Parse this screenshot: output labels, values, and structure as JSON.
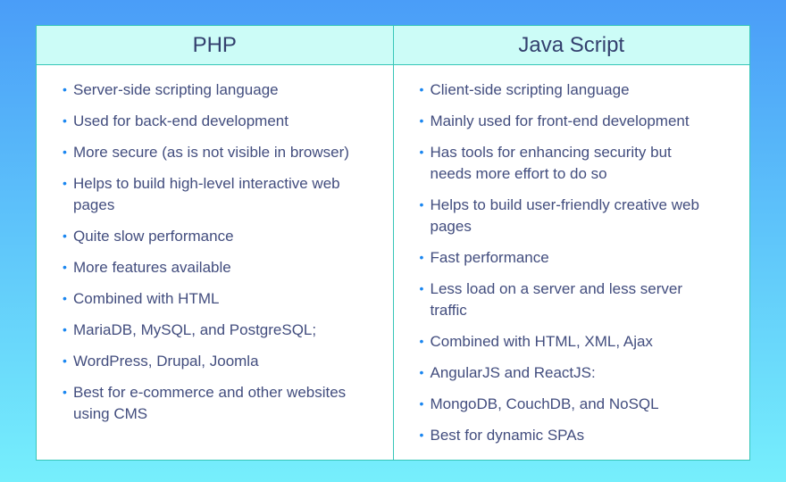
{
  "columns": [
    {
      "title": "PHP",
      "items": [
        "Server-side scripting language",
        "Used for back-end development",
        "More secure (as is not visible in browser)",
        "Helps to build high-level interactive web pages",
        "Quite slow performance",
        "More features available",
        "Combined with HTML",
        "MariaDB, MySQL, and PostgreSQL;",
        "WordPress, Drupal, Joomla",
        "Best for e-commerce and other websites using CMS"
      ]
    },
    {
      "title": "Java Script",
      "items": [
        "Client-side scripting language",
        "Mainly used for front-end development",
        "Has tools for enhancing security but needs more effort to do so",
        "Helps to build user-friendly creative web pages",
        "Fast performance",
        "Less load on a server and less server traffic",
        "Combined with HTML, XML, Ajax",
        "AngularJS and ReactJS:",
        "MongoDB, CouchDB, and NoSQL",
        "Best for dynamic SPAs"
      ]
    }
  ],
  "colors": {
    "border": "#36c6b8",
    "header_bg": "#ccfcf7",
    "bullet": "#1a86f0",
    "text": "#424d7e"
  }
}
